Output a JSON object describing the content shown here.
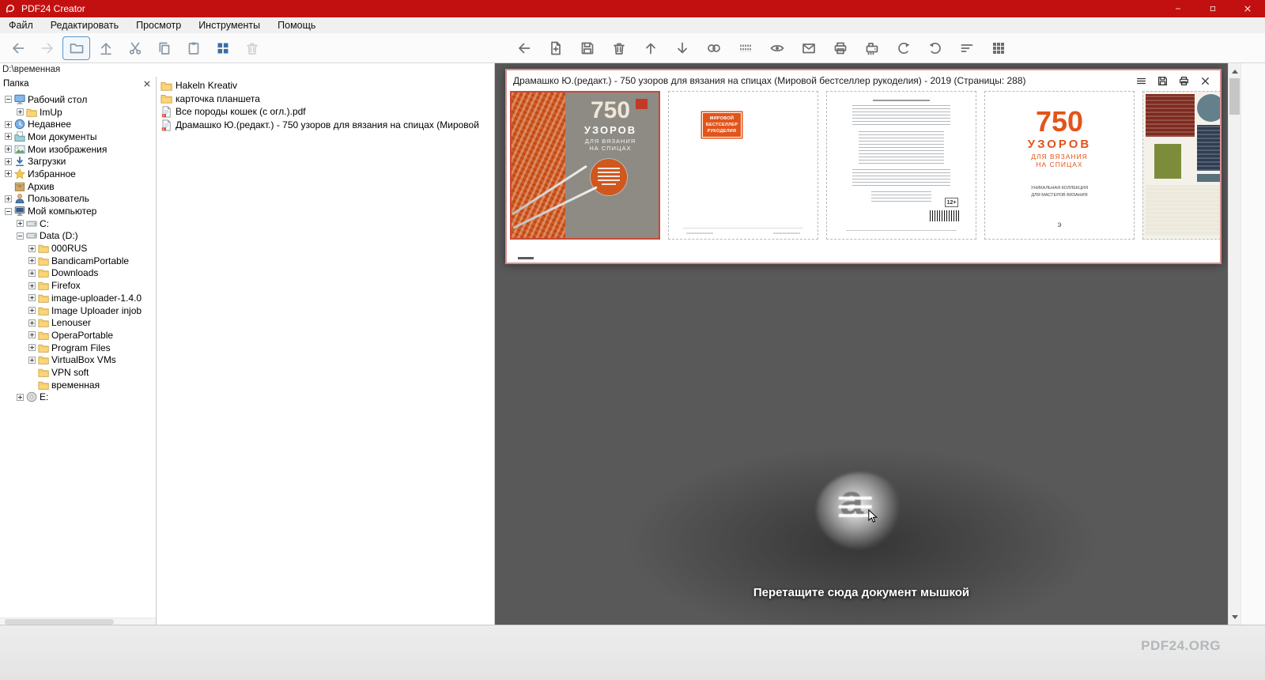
{
  "titlebar": {
    "title": "PDF24 Creator",
    "controls": [
      {
        "name": "minimize-button",
        "icon": "minimize-icon"
      },
      {
        "name": "maximize-button",
        "icon": "maximize-icon"
      },
      {
        "name": "close-button",
        "icon": "close-icon"
      }
    ]
  },
  "menu": {
    "items": [
      "Файл",
      "Редактировать",
      "Просмотр",
      "Инструменты",
      "Помощь"
    ]
  },
  "toolbar": {
    "left": [
      {
        "name": "nav-back-button",
        "icon": "nav-back-icon",
        "state": "normal"
      },
      {
        "name": "nav-forward-button",
        "icon": "nav-forward-icon",
        "state": "disabled"
      },
      {
        "name": "folder-browser-button",
        "icon": "folder-icon",
        "state": "selected"
      },
      {
        "name": "open-parent-button",
        "icon": "upload-icon",
        "state": "normal"
      },
      {
        "name": "cut-button",
        "icon": "cut-icon",
        "state": "normal"
      },
      {
        "name": "copy-button",
        "icon": "copy-icon",
        "state": "normal"
      },
      {
        "name": "paste-button",
        "icon": "paste-icon",
        "state": "normal"
      },
      {
        "name": "tile-view-button",
        "icon": "tiles-icon",
        "state": "accent"
      },
      {
        "name": "delete-button",
        "icon": "trash-icon",
        "state": "disabled"
      }
    ],
    "right": [
      {
        "name": "back-button",
        "icon": "arrow-left-icon",
        "state": "normal"
      },
      {
        "name": "add-document-button",
        "icon": "add-doc-icon",
        "state": "normal"
      },
      {
        "name": "save-button",
        "icon": "save-icon",
        "state": "normal"
      },
      {
        "name": "delete-page-button",
        "icon": "trash-icon",
        "state": "normal"
      },
      {
        "name": "move-up-button",
        "icon": "move-up-icon",
        "state": "normal"
      },
      {
        "name": "move-down-button",
        "icon": "move-down-icon",
        "state": "normal"
      },
      {
        "name": "combine-button",
        "icon": "rings-icon",
        "state": "normal"
      },
      {
        "name": "split-button",
        "icon": "binding-icon",
        "state": "normal"
      },
      {
        "name": "preview-button",
        "icon": "eye-icon",
        "state": "normal"
      },
      {
        "name": "email-button",
        "icon": "email-icon",
        "state": "normal"
      },
      {
        "name": "print-button",
        "icon": "print-icon",
        "state": "normal"
      },
      {
        "name": "fax-button",
        "icon": "fax-icon",
        "state": "normal"
      },
      {
        "name": "undo-button",
        "icon": "undo-icon",
        "state": "normal"
      },
      {
        "name": "redo-button",
        "icon": "redo-icon",
        "state": "normal"
      },
      {
        "name": "sort-button",
        "icon": "sort-icon",
        "state": "normal"
      },
      {
        "name": "grid-view-button",
        "icon": "grid-icon",
        "state": "normal"
      }
    ]
  },
  "pathbar": {
    "path": "D:\\временная"
  },
  "tree": {
    "header": "Папка",
    "items": [
      {
        "label": "Рабочий стол",
        "depth": 0,
        "toggle": "-",
        "icon": "desktop-icon"
      },
      {
        "label": "ImUp",
        "depth": 1,
        "toggle": "+",
        "icon": "folder-icon"
      },
      {
        "label": "Недавнее",
        "depth": 0,
        "toggle": "+",
        "icon": "recent-icon"
      },
      {
        "label": "Мои документы",
        "depth": 0,
        "toggle": "+",
        "icon": "documents-icon"
      },
      {
        "label": "Мои изображения",
        "depth": 0,
        "toggle": "+",
        "icon": "pictures-icon"
      },
      {
        "label": "Загрузки",
        "depth": 0,
        "toggle": "+",
        "icon": "downloads-icon"
      },
      {
        "label": "Избранное",
        "depth": 0,
        "toggle": "+",
        "icon": "favorites-icon"
      },
      {
        "label": "Архив",
        "depth": 0,
        "toggle": null,
        "icon": "archive-icon"
      },
      {
        "label": "Пользователь",
        "depth": 0,
        "toggle": "+",
        "icon": "user-icon"
      },
      {
        "label": "Мой компьютер",
        "depth": 0,
        "toggle": "-",
        "icon": "computer-icon"
      },
      {
        "label": "C:",
        "depth": 1,
        "toggle": "+",
        "icon": "drive-icon"
      },
      {
        "label": "Data (D:)",
        "depth": 1,
        "toggle": "-",
        "icon": "drive-icon"
      },
      {
        "label": "000RUS",
        "depth": 2,
        "toggle": "+",
        "icon": "folder-icon"
      },
      {
        "label": "BandicamPortable",
        "depth": 2,
        "toggle": "+",
        "icon": "folder-icon"
      },
      {
        "label": "Downloads",
        "depth": 2,
        "toggle": "+",
        "icon": "folder-icon"
      },
      {
        "label": "Firefox",
        "depth": 2,
        "toggle": "+",
        "icon": "folder-icon"
      },
      {
        "label": "image-uploader-1.4.0",
        "depth": 2,
        "toggle": "+",
        "icon": "folder-icon"
      },
      {
        "label": "Image Uploader injob",
        "depth": 2,
        "toggle": "+",
        "icon": "folder-icon"
      },
      {
        "label": "Lenouser",
        "depth": 2,
        "toggle": "+",
        "icon": "folder-icon"
      },
      {
        "label": "OperaPortable",
        "depth": 2,
        "toggle": "+",
        "icon": "folder-icon"
      },
      {
        "label": "Program Files",
        "depth": 2,
        "toggle": "+",
        "icon": "folder-icon"
      },
      {
        "label": "VirtualBox VMs",
        "depth": 2,
        "toggle": "+",
        "icon": "folder-icon"
      },
      {
        "label": "VPN soft",
        "depth": 2,
        "toggle": null,
        "icon": "folder-icon"
      },
      {
        "label": "временная",
        "depth": 2,
        "toggle": null,
        "icon": "folder-icon"
      },
      {
        "label": "E:",
        "depth": 1,
        "toggle": "+",
        "icon": "disc-icon"
      }
    ]
  },
  "files": {
    "items": [
      {
        "label": "Hakeln Kreativ",
        "icon": "folder-icon"
      },
      {
        "label": "карточка планшета",
        "icon": "folder-icon"
      },
      {
        "label": "Все породы кошек (с огл.).pdf",
        "icon": "pdf-file-icon"
      },
      {
        "label": "Драмашко Ю.(редакт.) - 750 узоров для вязания на спицах (Мировой",
        "icon": "pdf-file-icon"
      }
    ]
  },
  "preview": {
    "title": "Драмашко Ю.(редакт.) - 750 узоров для вязания на спицах (Мировой бестселлер рукоделия) - 2019 (Страницы: 288)",
    "buttons": [
      {
        "name": "preview-menu-button",
        "icon": "hamburger-icon"
      },
      {
        "name": "preview-save-button",
        "icon": "save-icon"
      },
      {
        "name": "preview-print-button",
        "icon": "print-icon"
      },
      {
        "name": "preview-close-button",
        "icon": "close-icon"
      }
    ],
    "pages": [
      {
        "kind": "cover",
        "selected": true,
        "text": {
          "big": "750",
          "l1": "УЗОРОВ",
          "l2": "ДЛЯ ВЯЗАНИЯ",
          "l3": "НА СПИЦАХ"
        }
      },
      {
        "kind": "badge",
        "badge": [
          "МИРОВОЙ",
          "БЕСТСЕЛЛЕР",
          "РУКОДЕЛИЯ"
        ]
      },
      {
        "kind": "textpage",
        "age": "12+"
      },
      {
        "kind": "titlepage",
        "text": {
          "big": "750",
          "l1": "УЗОРОВ",
          "l2": "ДЛЯ ВЯЗАНИЯ",
          "l3": "НА СПИЦАХ",
          "sub1": "УНИКАЛЬНАЯ КОЛЛЕКЦИЯ",
          "sub2": "ДЛЯ МАСТЕРОВ ВЯЗАНИЯ",
          "publisher": "э"
        }
      },
      {
        "kind": "swatches",
        "colors": [
          "#7e2a1e",
          "#64808d",
          "#2e3d52",
          "#7d8c3a",
          "#ece8db",
          "#57707c"
        ]
      }
    ]
  },
  "dropzone": {
    "text": "Перетащите сюда документ мышкой",
    "logo_glyph": "a"
  },
  "footer": {
    "watermark": "PDF24.ORG"
  },
  "colors": {
    "titlebar_red": "#c21010",
    "accent_orange": "#e2551a",
    "workspace_gray": "#595959",
    "preview_border": "#d98f8f",
    "selected_page_border": "#c94a35"
  }
}
